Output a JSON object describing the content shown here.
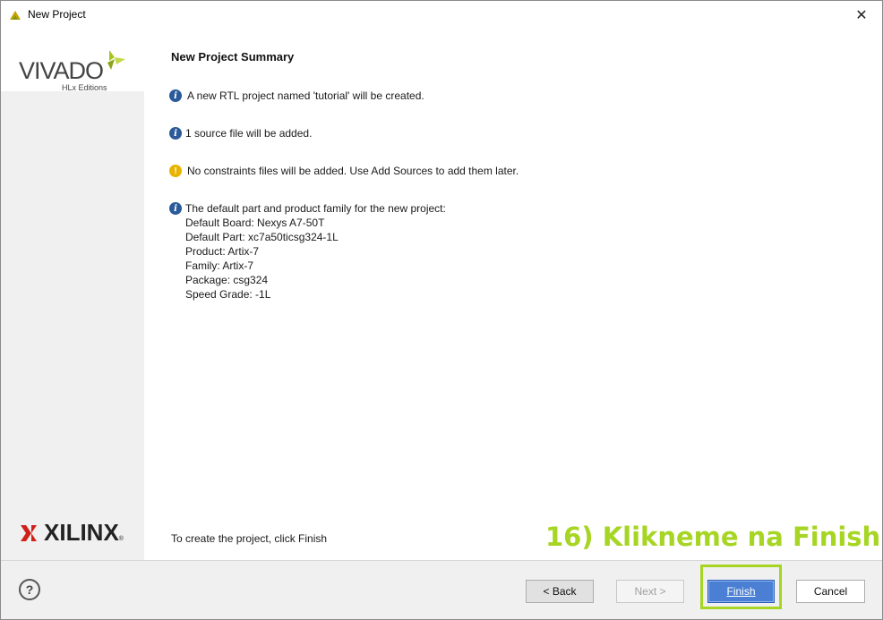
{
  "window": {
    "title": "New Project",
    "close_glyph": "✕"
  },
  "sidebar": {
    "vivado_logo": "VIVADO",
    "vivado_sub": "HLx Editions",
    "xilinx_logo": "XILINX",
    "xilinx_reg": "®"
  },
  "content": {
    "heading": "New Project Summary",
    "messages": [
      {
        "icon": "info-icon",
        "text": "A new RTL project named 'tutorial' will be created."
      },
      {
        "icon": "info-icon",
        "text": "1 source file will be added."
      },
      {
        "icon": "warning-icon",
        "text": "No constraints files will be added. Use Add Sources to add them later."
      },
      {
        "icon": "info-icon",
        "text": "The default part and product family for the new project:"
      }
    ],
    "part_details": [
      "Default Board: Nexys A7-50T",
      "Default Part: xc7a50ticsg324-1L",
      "Product: Artix-7",
      "Family: Artix-7",
      "Package: csg324",
      "Speed Grade: -1L"
    ],
    "footer_note": "To create the project, click Finish",
    "annotation": "16) Klikneme na Finish"
  },
  "buttons": {
    "help": "?",
    "back": "< Back",
    "next": "Next >",
    "finish": "Finish",
    "cancel": "Cancel"
  },
  "colors": {
    "annotation": "#a6d523",
    "finish_button": "#4a7fd4",
    "info_icon": "#2b5a9a",
    "warning_icon": "#e8b400"
  }
}
